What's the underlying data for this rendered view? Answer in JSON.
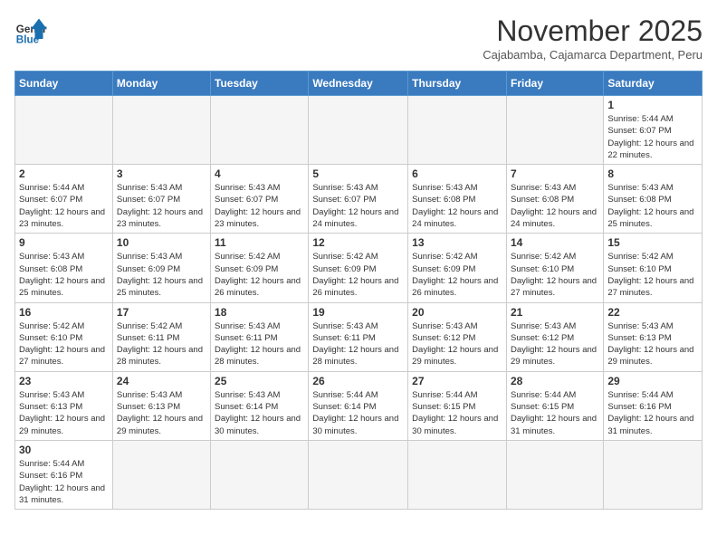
{
  "header": {
    "logo_general": "General",
    "logo_blue": "Blue",
    "month_title": "November 2025",
    "subtitle": "Cajabamba, Cajamarca Department, Peru"
  },
  "days_of_week": [
    "Sunday",
    "Monday",
    "Tuesday",
    "Wednesday",
    "Thursday",
    "Friday",
    "Saturday"
  ],
  "weeks": [
    [
      {
        "day": "",
        "info": ""
      },
      {
        "day": "",
        "info": ""
      },
      {
        "day": "",
        "info": ""
      },
      {
        "day": "",
        "info": ""
      },
      {
        "day": "",
        "info": ""
      },
      {
        "day": "",
        "info": ""
      },
      {
        "day": "1",
        "info": "Sunrise: 5:44 AM\nSunset: 6:07 PM\nDaylight: 12 hours and 22 minutes."
      }
    ],
    [
      {
        "day": "2",
        "info": "Sunrise: 5:44 AM\nSunset: 6:07 PM\nDaylight: 12 hours and 23 minutes."
      },
      {
        "day": "3",
        "info": "Sunrise: 5:43 AM\nSunset: 6:07 PM\nDaylight: 12 hours and 23 minutes."
      },
      {
        "day": "4",
        "info": "Sunrise: 5:43 AM\nSunset: 6:07 PM\nDaylight: 12 hours and 23 minutes."
      },
      {
        "day": "5",
        "info": "Sunrise: 5:43 AM\nSunset: 6:07 PM\nDaylight: 12 hours and 24 minutes."
      },
      {
        "day": "6",
        "info": "Sunrise: 5:43 AM\nSunset: 6:08 PM\nDaylight: 12 hours and 24 minutes."
      },
      {
        "day": "7",
        "info": "Sunrise: 5:43 AM\nSunset: 6:08 PM\nDaylight: 12 hours and 24 minutes."
      },
      {
        "day": "8",
        "info": "Sunrise: 5:43 AM\nSunset: 6:08 PM\nDaylight: 12 hours and 25 minutes."
      }
    ],
    [
      {
        "day": "9",
        "info": "Sunrise: 5:43 AM\nSunset: 6:08 PM\nDaylight: 12 hours and 25 minutes."
      },
      {
        "day": "10",
        "info": "Sunrise: 5:43 AM\nSunset: 6:09 PM\nDaylight: 12 hours and 25 minutes."
      },
      {
        "day": "11",
        "info": "Sunrise: 5:42 AM\nSunset: 6:09 PM\nDaylight: 12 hours and 26 minutes."
      },
      {
        "day": "12",
        "info": "Sunrise: 5:42 AM\nSunset: 6:09 PM\nDaylight: 12 hours and 26 minutes."
      },
      {
        "day": "13",
        "info": "Sunrise: 5:42 AM\nSunset: 6:09 PM\nDaylight: 12 hours and 26 minutes."
      },
      {
        "day": "14",
        "info": "Sunrise: 5:42 AM\nSunset: 6:10 PM\nDaylight: 12 hours and 27 minutes."
      },
      {
        "day": "15",
        "info": "Sunrise: 5:42 AM\nSunset: 6:10 PM\nDaylight: 12 hours and 27 minutes."
      }
    ],
    [
      {
        "day": "16",
        "info": "Sunrise: 5:42 AM\nSunset: 6:10 PM\nDaylight: 12 hours and 27 minutes."
      },
      {
        "day": "17",
        "info": "Sunrise: 5:42 AM\nSunset: 6:11 PM\nDaylight: 12 hours and 28 minutes."
      },
      {
        "day": "18",
        "info": "Sunrise: 5:43 AM\nSunset: 6:11 PM\nDaylight: 12 hours and 28 minutes."
      },
      {
        "day": "19",
        "info": "Sunrise: 5:43 AM\nSunset: 6:11 PM\nDaylight: 12 hours and 28 minutes."
      },
      {
        "day": "20",
        "info": "Sunrise: 5:43 AM\nSunset: 6:12 PM\nDaylight: 12 hours and 29 minutes."
      },
      {
        "day": "21",
        "info": "Sunrise: 5:43 AM\nSunset: 6:12 PM\nDaylight: 12 hours and 29 minutes."
      },
      {
        "day": "22",
        "info": "Sunrise: 5:43 AM\nSunset: 6:13 PM\nDaylight: 12 hours and 29 minutes."
      }
    ],
    [
      {
        "day": "23",
        "info": "Sunrise: 5:43 AM\nSunset: 6:13 PM\nDaylight: 12 hours and 29 minutes."
      },
      {
        "day": "24",
        "info": "Sunrise: 5:43 AM\nSunset: 6:13 PM\nDaylight: 12 hours and 29 minutes."
      },
      {
        "day": "25",
        "info": "Sunrise: 5:43 AM\nSunset: 6:14 PM\nDaylight: 12 hours and 30 minutes."
      },
      {
        "day": "26",
        "info": "Sunrise: 5:44 AM\nSunset: 6:14 PM\nDaylight: 12 hours and 30 minutes."
      },
      {
        "day": "27",
        "info": "Sunrise: 5:44 AM\nSunset: 6:15 PM\nDaylight: 12 hours and 30 minutes."
      },
      {
        "day": "28",
        "info": "Sunrise: 5:44 AM\nSunset: 6:15 PM\nDaylight: 12 hours and 31 minutes."
      },
      {
        "day": "29",
        "info": "Sunrise: 5:44 AM\nSunset: 6:16 PM\nDaylight: 12 hours and 31 minutes."
      }
    ],
    [
      {
        "day": "30",
        "info": "Sunrise: 5:44 AM\nSunset: 6:16 PM\nDaylight: 12 hours and 31 minutes."
      },
      {
        "day": "",
        "info": ""
      },
      {
        "day": "",
        "info": ""
      },
      {
        "day": "",
        "info": ""
      },
      {
        "day": "",
        "info": ""
      },
      {
        "day": "",
        "info": ""
      },
      {
        "day": "",
        "info": ""
      }
    ]
  ]
}
